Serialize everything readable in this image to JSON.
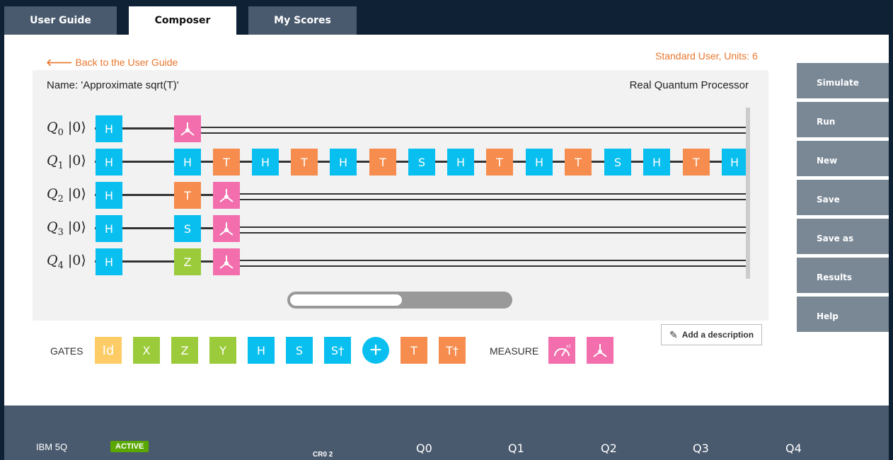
{
  "tabs": [
    {
      "label": "User Guide",
      "active": false
    },
    {
      "label": "Composer",
      "active": true
    },
    {
      "label": "My Scores",
      "active": false
    }
  ],
  "back_link": "Back to the User Guide",
  "user_units": "Standard User, Units: 6",
  "circuit": {
    "name": "Name: 'Approximate sqrt(T)'",
    "backend": "Real Quantum Processor",
    "ket": "|0⟩",
    "qubits": [
      {
        "label": "Q",
        "index": "0"
      },
      {
        "label": "Q",
        "index": "1"
      },
      {
        "label": "Q",
        "index": "2"
      },
      {
        "label": "Q",
        "index": "3"
      },
      {
        "label": "Q",
        "index": "4"
      }
    ],
    "gates": {
      "q0": [
        "H"
      ],
      "q1": [
        "H",
        "H",
        "T",
        "H",
        "T",
        "H",
        "T",
        "S",
        "H",
        "T",
        "H",
        "T",
        "S",
        "H",
        "T",
        "H"
      ],
      "q2": [
        "H",
        "T"
      ],
      "q3": [
        "H",
        "S"
      ],
      "q4": [
        "H",
        "Z"
      ]
    }
  },
  "palette": {
    "gates_label": "GATES",
    "measure_label": "MEASURE",
    "gates": [
      "Id",
      "X",
      "Z",
      "Y",
      "H",
      "S",
      "S†",
      "+",
      "T",
      "T†"
    ]
  },
  "add_description": "Add a description",
  "sidebar": [
    "Simulate",
    "Run",
    "New",
    "Save",
    "Save as",
    "Results",
    "Help"
  ],
  "footer": {
    "device": "IBM 5Q",
    "status": "ACTIVE",
    "register": "CR0 2",
    "qubits": [
      "Q0",
      "Q1",
      "Q2",
      "Q3",
      "Q4"
    ]
  },
  "colors": {
    "h_gate": "#09bfef",
    "t_gate": "#f68d4f",
    "pauli_gate": "#9bcb3a",
    "measure_gate": "#f26eac",
    "id_gate": "#fdcc66",
    "accent": "#e8772e"
  }
}
